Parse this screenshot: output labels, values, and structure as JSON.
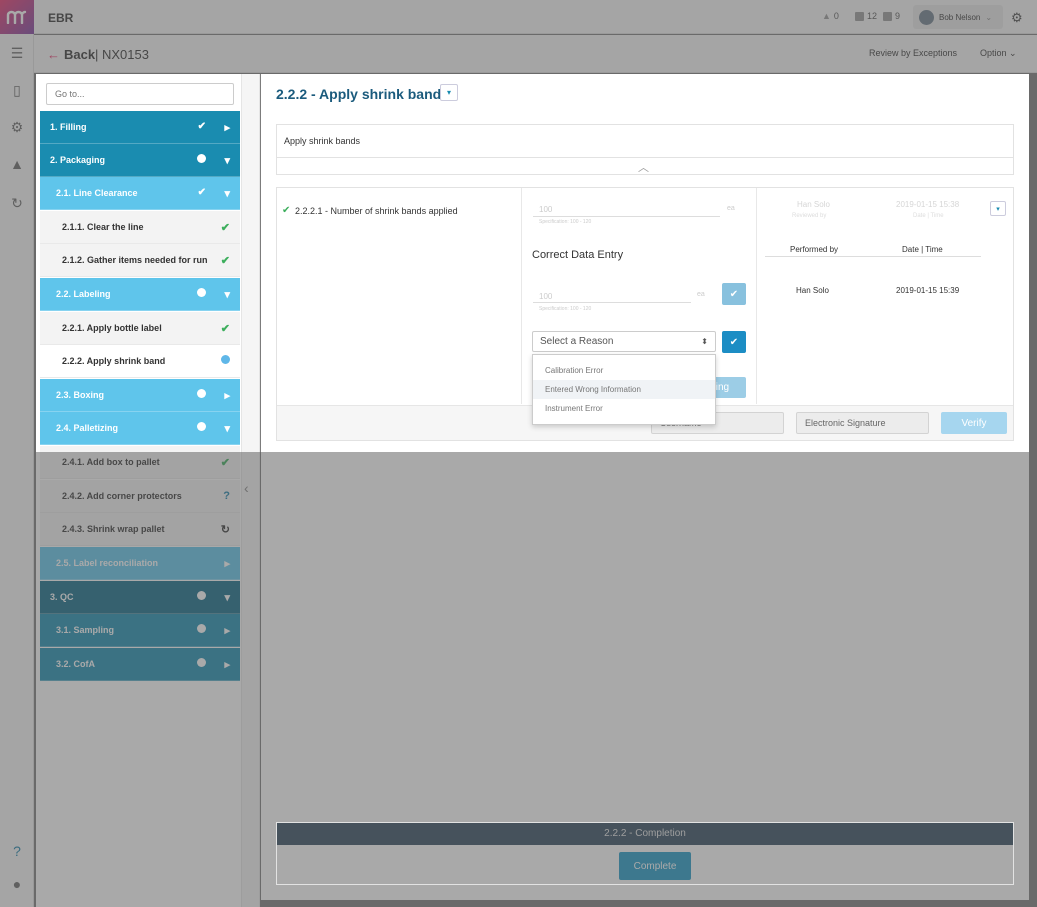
{
  "app": {
    "title": "EBR"
  },
  "header": {
    "alerts": "0",
    "messages": "12",
    "tasks": "9",
    "user_name": "Bob Nelson",
    "icons": [
      "alert-icon",
      "message-icon",
      "task-icon",
      "avatar",
      "chevron-down-icon",
      "gear-icon"
    ]
  },
  "subheader": {
    "back": "Back",
    "batch": "| NX0153",
    "review": "Review by Exceptions",
    "option": "Option"
  },
  "nav": {
    "goto_placeholder": "Go to...",
    "items": [
      {
        "label": "1.  Filling",
        "status": "check"
      },
      {
        "label": "2.  Packaging",
        "status": "dot"
      },
      {
        "label": "2.1.  Line Clearance",
        "status": "check"
      },
      {
        "label": "2.1.1.   Clear the line",
        "status": "check"
      },
      {
        "label": "2.1.2.   Gather items needed for run",
        "status": "check"
      },
      {
        "label": "2.2.  Labeling",
        "status": "dot"
      },
      {
        "label": "2.2.1.   Apply bottle label",
        "status": "check"
      },
      {
        "label": "2.2.2.   Apply shrink band",
        "status": "dot"
      },
      {
        "label": "2.3.  Boxing",
        "status": "dot"
      },
      {
        "label": "2.4.  Palletizing",
        "status": "dot"
      },
      {
        "label": "2.4.1.   Add box to pallet",
        "status": "check"
      },
      {
        "label": "2.4.2.   Add corner protectors",
        "status": "help"
      },
      {
        "label": "2.4.3.   Shrink wrap pallet",
        "status": "refresh"
      },
      {
        "label": "2.5.  Label reconciliation",
        "status": "none"
      },
      {
        "label": "3.  QC",
        "status": "dot"
      },
      {
        "label": "3.1.  Sampling",
        "status": "dot"
      },
      {
        "label": "3.2.  CofA",
        "status": "dot"
      }
    ]
  },
  "step": {
    "title": "2.2.2 - Apply shrink band",
    "instruction": "Apply shrink bands",
    "entry_label": "2.2.2.1 - Number of shrink bands applied",
    "original_value": "100",
    "original_unit": "ea",
    "original_hint": "Specification: 100 - 120",
    "correct_title": "Correct Data Entry",
    "new_value": "100",
    "new_unit": "ea",
    "new_hint": "Specification: 100 - 120",
    "reason_placeholder": "Select a Reason",
    "reasons": [
      "Calibration Error",
      "Entered Wrong Information",
      "Instrument Error"
    ],
    "correcting_label": "cting",
    "reviewer_name": "Han Solo",
    "reviewer_role": "Reviewed by",
    "reviewer_date": "2019-01-15 15:38",
    "reviewer_date_label": "Date | Time",
    "performed_by_header": "Performed by",
    "date_header": "Date | Time",
    "performed_by": "Han Solo",
    "performed_date": "2019-01-15 15:39",
    "username_placeholder": "Username",
    "esig_placeholder": "Electronic Signature",
    "verify": "Verify"
  },
  "completion": {
    "title": "2.2.2 - Completion",
    "button": "Complete"
  }
}
